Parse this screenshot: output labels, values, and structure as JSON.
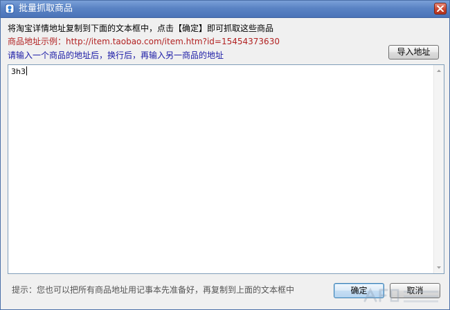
{
  "window": {
    "title": "批量抓取商品",
    "icon": "app-logo-icon",
    "close_icon": "close-icon",
    "close_color": "#c8412b",
    "title_bar_color": "#5a83c4"
  },
  "instructions": {
    "line1": "将淘宝详情地址复制到下面的文本框中，点击【确定】即可抓取这些商品",
    "example": "商品地址示例：http://item.taobao.com/item.htm?id=15454373630",
    "multi": "请输入一个商品的地址后，换行后，再输入另一商品的地址",
    "example_color": "#b22222",
    "multi_color": "#1a1aa6"
  },
  "toolbar": {
    "import_label": "导入地址"
  },
  "editor": {
    "value": "3h3"
  },
  "footer": {
    "tip": "提示：您也可以把所有商品地址用记事本先准备好，再复制到上面的文本框中",
    "ok_label": "确定",
    "cancel_label": "取消"
  }
}
